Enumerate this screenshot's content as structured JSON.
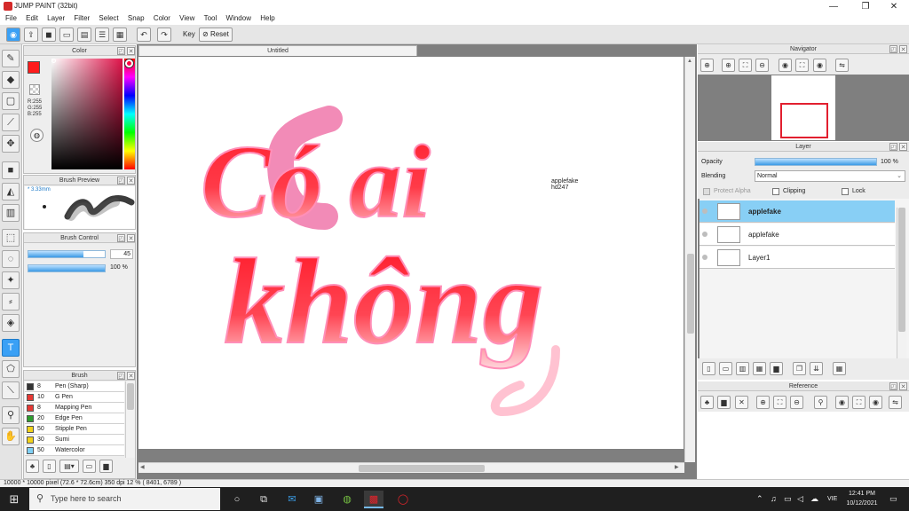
{
  "window": {
    "title": "JUMP PAINT (32bit)",
    "minimize": "—",
    "maximize": "❐",
    "close": "✕"
  },
  "menu": [
    "File",
    "Edit",
    "Layer",
    "Filter",
    "Select",
    "Snap",
    "Color",
    "View",
    "Tool",
    "Window",
    "Help"
  ],
  "toolbar": {
    "key_label": "Key",
    "reset_label": "Reset"
  },
  "panels": {
    "color": {
      "title": "Color",
      "r": "R:255",
      "g": "G:255",
      "b": "B:255",
      "primary_color": "#ff1b1b",
      "secondary_color": "#ffffff"
    },
    "brush_preview": {
      "title": "Brush Preview",
      "size": "3.33mm"
    },
    "brush_control": {
      "title": "Brush Control",
      "size_value": "45",
      "size_fraction": 0.72,
      "opacity_value": "100 %",
      "opacity_fraction": 1.0
    },
    "brush": {
      "title": "Brush",
      "items": [
        {
          "size": "8",
          "name": "Pen (Sharp)",
          "color": "#333333"
        },
        {
          "size": "10",
          "name": "G Pen",
          "color": "#e53935"
        },
        {
          "size": "8",
          "name": "Mapping Pen",
          "color": "#e53935"
        },
        {
          "size": "20",
          "name": "Edge Pen",
          "color": "#2e9e2e"
        },
        {
          "size": "50",
          "name": "Stipple Pen",
          "color": "#f1d21b"
        },
        {
          "size": "30",
          "name": "Sumi",
          "color": "#f1d21b"
        },
        {
          "size": "50",
          "name": "Watercolor",
          "color": "#7fd0f5"
        }
      ]
    },
    "navigator": {
      "title": "Navigator"
    },
    "layer": {
      "title": "Layer",
      "opacity_label": "Opacity",
      "opacity_value": "100 %",
      "opacity_fraction": 1.0,
      "blending_label": "Blending",
      "blending_value": "Normal",
      "protect_alpha": "Protect Alpha",
      "clipping": "Clipping",
      "lock": "Lock",
      "layers": [
        {
          "name": "applefake",
          "selected": true
        },
        {
          "name": "applefake",
          "selected": false
        },
        {
          "name": "Layer1",
          "selected": false
        }
      ]
    },
    "reference": {
      "title": "Reference"
    }
  },
  "document": {
    "tab_title": "Untitled",
    "canvas_text_line1": "Có ai",
    "canvas_text_line2": "không",
    "watermark_line1": "applefake",
    "watermark_line2": "hd247",
    "text_color": "#ff3342"
  },
  "status": {
    "text": "10000 * 10000 pixel   (72.6 * 72.6cm)   350 dpi   12 %   ( 8401, 6789 )"
  },
  "taskbar": {
    "search_placeholder": "Type here to search",
    "lang": "VIE",
    "time": "12:41 PM",
    "date": "10/12/2021"
  }
}
